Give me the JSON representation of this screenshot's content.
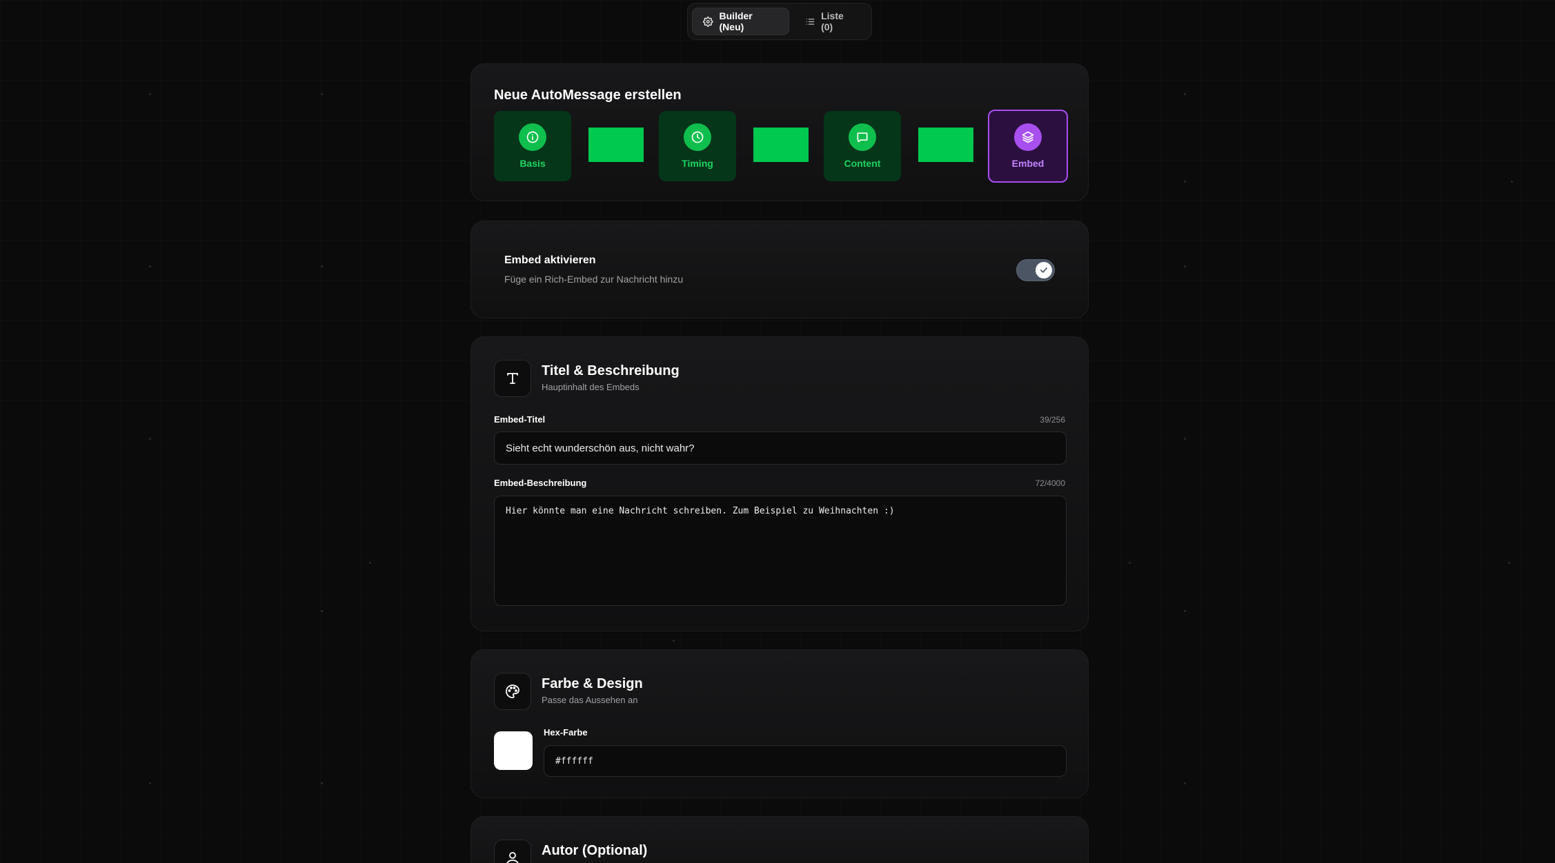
{
  "tabs": [
    {
      "label": "Builder (Neu)",
      "icon": "gear-icon",
      "active": true
    },
    {
      "label": "Liste (0)",
      "icon": "list-icon",
      "active": false
    }
  ],
  "builder": {
    "title": "Neue AutoMessage erstellen",
    "steps": [
      {
        "label": "Basis",
        "icon": "info-icon",
        "state": "done"
      },
      {
        "label": "Timing",
        "icon": "clock-icon",
        "state": "done"
      },
      {
        "label": "Content",
        "icon": "message-icon",
        "state": "done"
      },
      {
        "label": "Embed",
        "icon": "layers-icon",
        "state": "active"
      }
    ]
  },
  "embed_toggle": {
    "title": "Embed aktivieren",
    "subtitle": "Füge ein Rich-Embed zur Nachricht hinzu",
    "enabled": true
  },
  "title_section": {
    "title": "Titel & Beschreibung",
    "subtitle": "Hauptinhalt des Embeds",
    "embed_title_label": "Embed-Titel",
    "embed_title_counter": "39/256",
    "embed_title_value": "Sieht echt wunderschön aus, nicht wahr?",
    "embed_desc_label": "Embed-Beschreibung",
    "embed_desc_counter": "72/4000",
    "embed_desc_value": "Hier könnte man eine Nachricht schreiben. Zum Beispiel zu Weihnachten :)"
  },
  "color_section": {
    "title": "Farbe & Design",
    "subtitle": "Passe das Aussehen an",
    "hex_label": "Hex-Farbe",
    "hex_value": "#ffffff"
  },
  "author_section": {
    "title": "Autor (Optional)"
  },
  "colors": {
    "accent_green": "#00c94f",
    "accent_purple": "#a84ff0",
    "background": "#0b0b0c"
  }
}
